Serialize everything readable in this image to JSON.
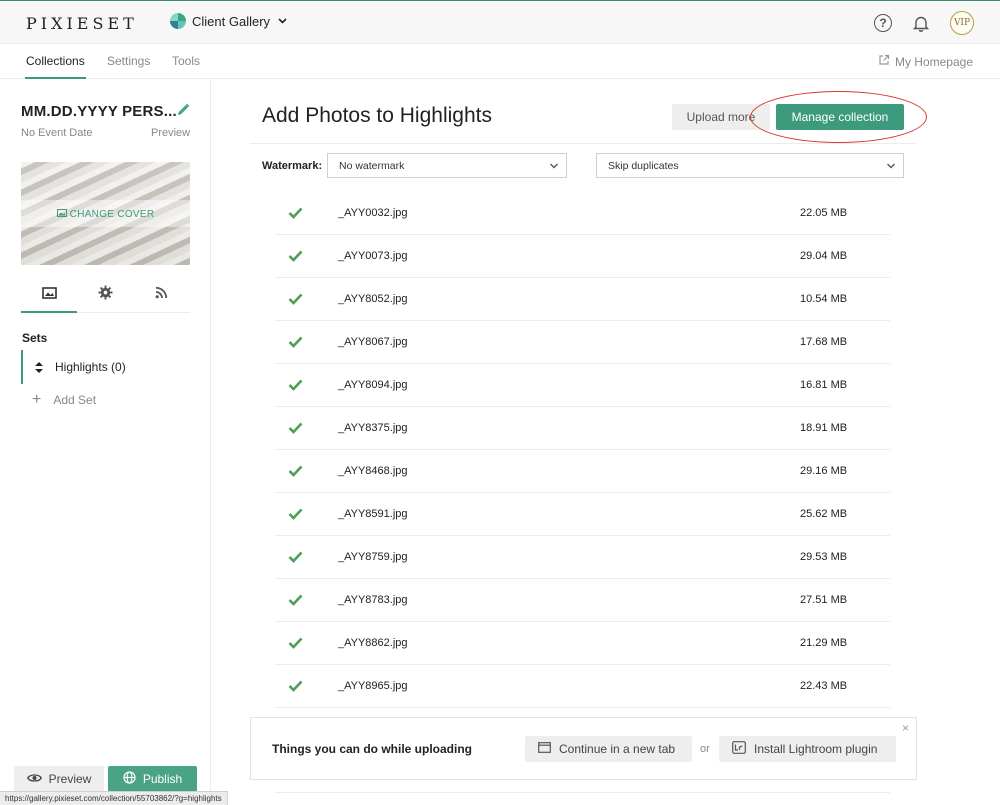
{
  "topbar": {
    "logo": "PIXIESET",
    "app_switcher": "Client Gallery",
    "help_glyph": "?",
    "vip": "VIP"
  },
  "nav": {
    "tabs": [
      {
        "label": "Collections",
        "active": true
      },
      {
        "label": "Settings",
        "active": false
      },
      {
        "label": "Tools",
        "active": false
      }
    ],
    "homepage": "My Homepage"
  },
  "sidebar": {
    "collection_title": "MM.DD.YYYY PERS...",
    "event_date": "No Event Date",
    "preview": "Preview",
    "change_cover": "CHANGE COVER",
    "tabs": [
      "image-icon",
      "gear-icon",
      "rss-icon"
    ],
    "sets_heading": "Sets",
    "sets": [
      {
        "label": "Highlights (0)"
      }
    ],
    "add_set": "Add Set",
    "preview_button": "Preview",
    "publish_button": "Publish"
  },
  "status_bar": "https://gallery.pixieset.com/collection/55703862/?g=highlights",
  "main": {
    "title": "Add Photos to Highlights",
    "upload_more": "Upload more",
    "manage_collection": "Manage collection",
    "watermark_label": "Watermark:",
    "watermark_value": "No watermark",
    "duplicates_value": "Skip duplicates",
    "files": [
      {
        "name": "_AYY0032.jpg",
        "size": "22.05 MB"
      },
      {
        "name": "_AYY0073.jpg",
        "size": "29.04 MB"
      },
      {
        "name": "_AYY8052.jpg",
        "size": "10.54 MB"
      },
      {
        "name": "_AYY8067.jpg",
        "size": "17.68 MB"
      },
      {
        "name": "_AYY8094.jpg",
        "size": "16.81 MB"
      },
      {
        "name": "_AYY8375.jpg",
        "size": "18.91 MB"
      },
      {
        "name": "_AYY8468.jpg",
        "size": "29.16 MB"
      },
      {
        "name": "_AYY8591.jpg",
        "size": "25.62 MB"
      },
      {
        "name": "_AYY8759.jpg",
        "size": "29.53 MB"
      },
      {
        "name": "_AYY8783.jpg",
        "size": "27.51 MB"
      },
      {
        "name": "_AYY8862.jpg",
        "size": "21.29 MB"
      },
      {
        "name": "_AYY8965.jpg",
        "size": "22.43 MB"
      }
    ],
    "tip": {
      "text": "Things you can do while uploading",
      "continue_tab": "Continue in a new tab",
      "or": "or",
      "lightroom": "Install Lightroom plugin",
      "close": "×"
    }
  },
  "colors": {
    "accent": "#3c9b7d",
    "publish": "#4aa385",
    "check": "#4a9e56",
    "annotation": "#d63b2f"
  }
}
